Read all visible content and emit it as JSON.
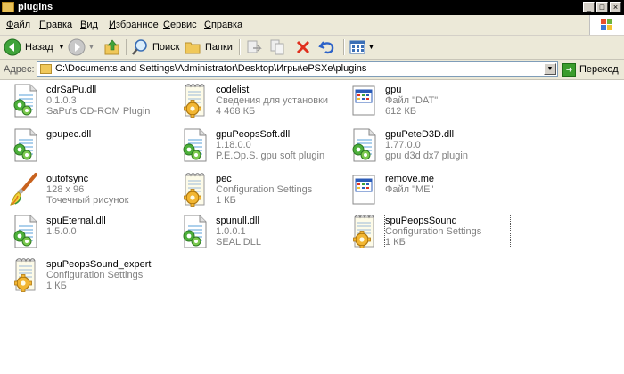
{
  "window": {
    "title": "plugins"
  },
  "menu": [
    "Файл",
    "Правка",
    "Вид",
    "Избранное",
    "Сервис",
    "Справка"
  ],
  "toolbar": {
    "back_label": "Назад",
    "search_label": "Поиск",
    "folders_label": "Папки"
  },
  "address": {
    "label": "Адрес:",
    "path": "C:\\Documents and Settings\\Administrator\\Desktop\\Игры\\ePSXe\\plugins",
    "go_label": "Переход"
  },
  "files": [
    {
      "name": "cdrSaPu.dll",
      "line2": "0.1.0.3",
      "line3": "SaPu's CD-ROM Plugin",
      "icon": "dll-icon"
    },
    {
      "name": "codelist",
      "line2": "Сведения для установки",
      "line3": "4 468 КБ",
      "icon": "config-icon"
    },
    {
      "name": "gpu",
      "line2": "Файл \"DAT\"",
      "line3": "612 КБ",
      "icon": "window-file-icon"
    },
    {
      "name": "gpupec.dll",
      "line2": "",
      "line3": "",
      "icon": "dll-icon"
    },
    {
      "name": "gpuPeopsSoft.dll",
      "line2": "1.18.0.0",
      "line3": "P.E.Op.S. gpu soft plugin",
      "icon": "dll-icon"
    },
    {
      "name": "gpuPeteD3D.dll",
      "line2": "1.77.0.0",
      "line3": "gpu d3d dx7 plugin",
      "icon": "dll-icon"
    },
    {
      "name": "outofsync",
      "line2": "128 x 96",
      "line3": "Точечный рисунок",
      "icon": "paint-brush-icon"
    },
    {
      "name": "pec",
      "line2": "Configuration Settings",
      "line3": "1 КБ",
      "icon": "config-icon"
    },
    {
      "name": "remove.me",
      "line2": "Файл \"ME\"",
      "line3": "",
      "icon": "window-file-icon"
    },
    {
      "name": "spuEternal.dll",
      "line2": "1.5.0.0",
      "line3": "",
      "icon": "dll-icon"
    },
    {
      "name": "spunull.dll",
      "line2": "1.0.0.1",
      "line3": "SEAL DLL",
      "icon": "dll-icon"
    },
    {
      "name": "spuPeopsSound",
      "line2": "Configuration Settings",
      "line3": "1 КБ",
      "icon": "config-icon",
      "selected": true
    },
    {
      "name": "spuPeopsSound_expert",
      "line2": "Configuration Settings",
      "line3": "1 КБ",
      "icon": "config-icon"
    }
  ]
}
